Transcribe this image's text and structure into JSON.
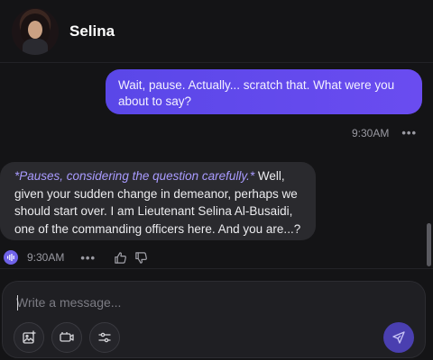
{
  "header": {
    "name": "Selina"
  },
  "messages": {
    "user": {
      "text": "Wait, pause. Actually... scratch that. What were you about to say?",
      "time": "9:30AM"
    },
    "bot": {
      "action": "*Pauses, considering the question carefully.*",
      "text": " Well, given your sudden change in demeanor, perhaps we should start over. I am Lieutenant Selina Al-Busaidi, one of the commanding officers here. And you are...?",
      "time": "9:30AM"
    }
  },
  "composer": {
    "placeholder": "Write a message..."
  },
  "icons": {
    "more": "•••",
    "voice": "soundwave-icon",
    "thumbs_up": "thumbs-up-icon",
    "thumbs_down": "thumbs-down-icon",
    "image": "image-icon",
    "video": "video-icon",
    "settings": "sliders-icon",
    "send": "send-icon"
  },
  "colors": {
    "accent": "#5a47e8",
    "action_text": "#a99bff",
    "background": "#141416",
    "bot_bubble": "#2a2a2e"
  }
}
